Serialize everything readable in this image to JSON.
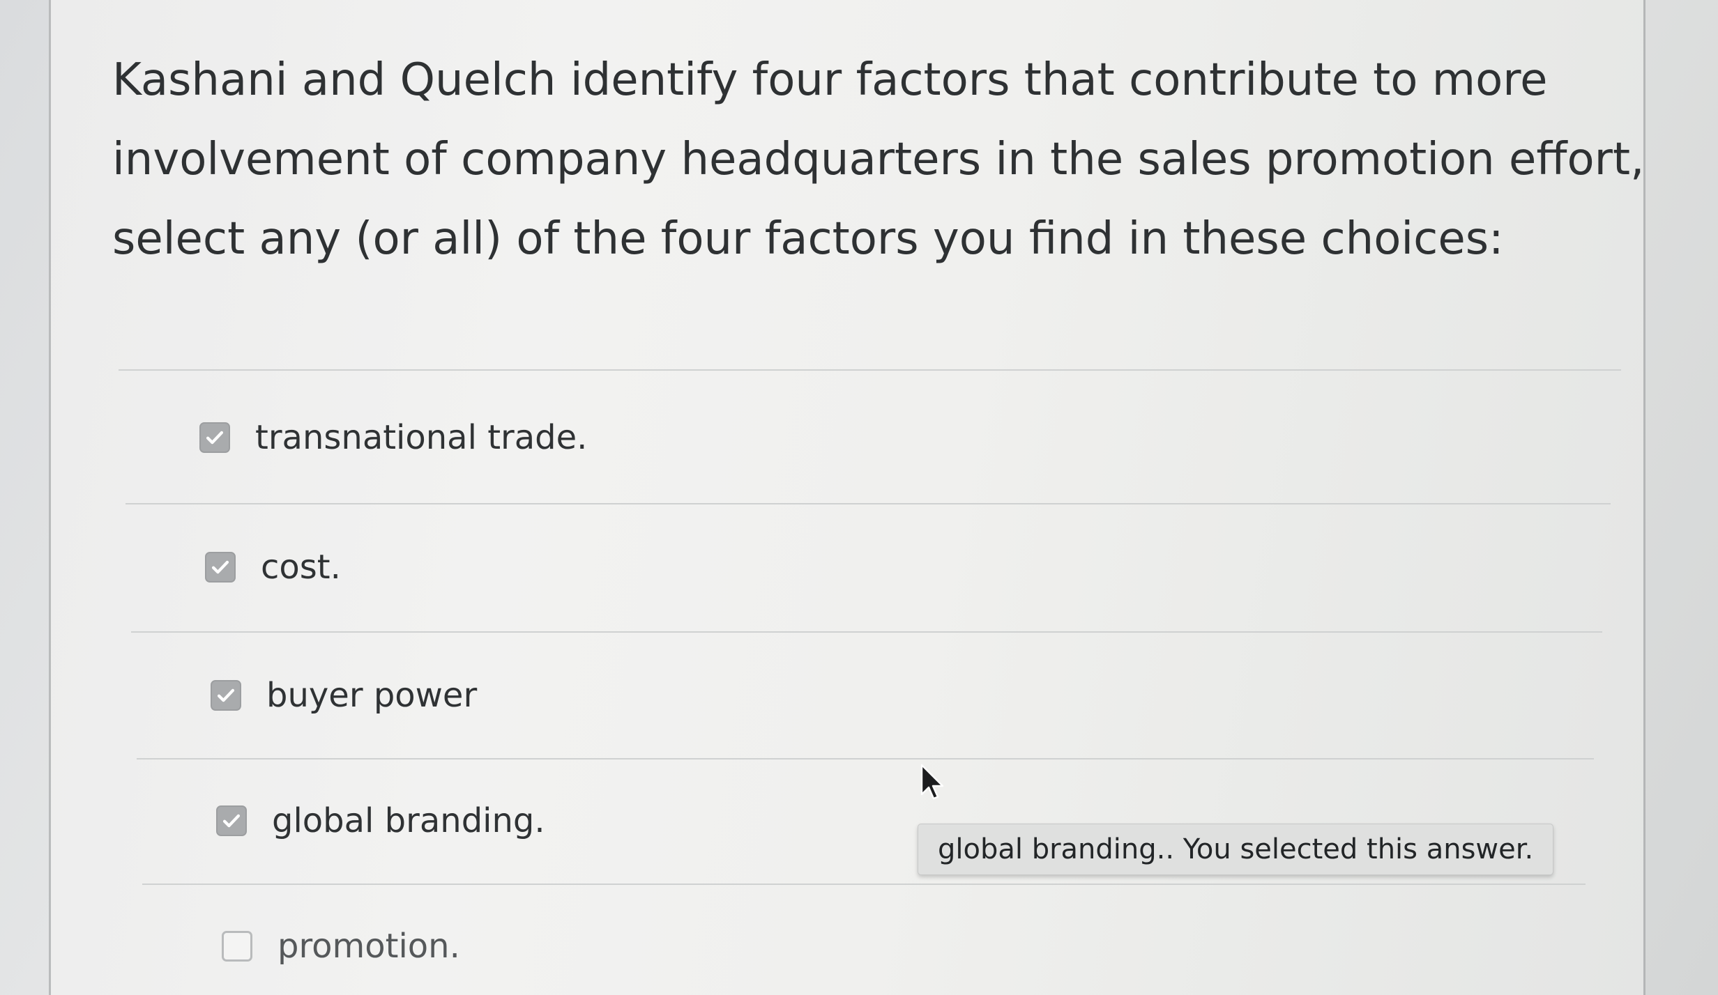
{
  "question": {
    "text": "Kashani and Quelch identify four factors that contribute to more involvement of company headquarters in the sales promotion effort, select any (or all) of the four factors you find in these choices:"
  },
  "options": [
    {
      "label": "transnational trade.",
      "checked": true
    },
    {
      "label": "cost.",
      "checked": true
    },
    {
      "label": "buyer power",
      "checked": true
    },
    {
      "label": "global branding.",
      "checked": true
    },
    {
      "label": "promotion.",
      "checked": false
    }
  ],
  "tooltip": {
    "text": "global branding.. You selected this answer."
  },
  "icons": {
    "checkbox_checked": "checkmark-icon",
    "cursor": "mouse-pointer-icon"
  },
  "colors": {
    "checkbox_checked_fill": "#a9abad",
    "text": "#2e3133",
    "divider": "#cfd1d1"
  }
}
